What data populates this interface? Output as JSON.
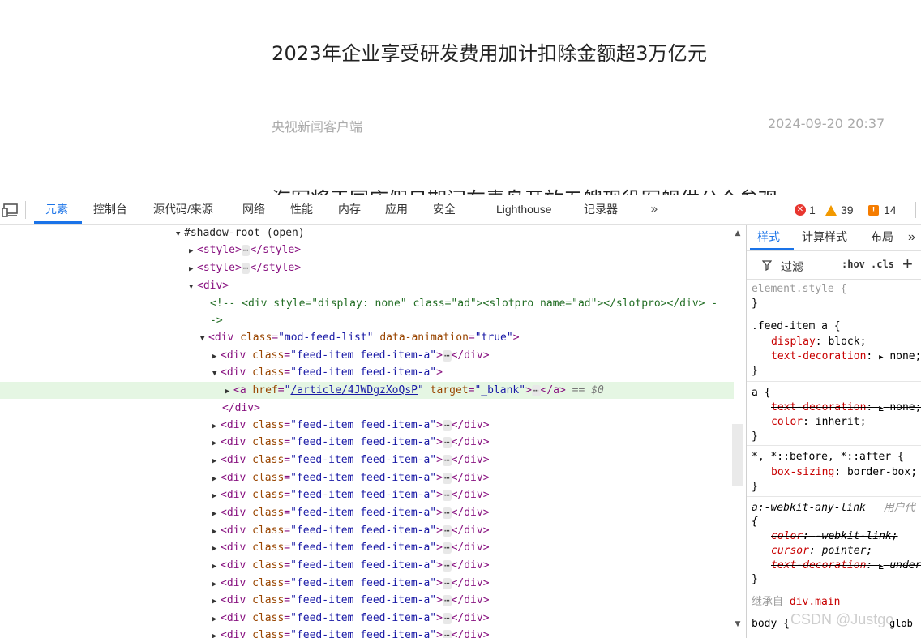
{
  "page": {
    "article_title": "2023年企业享受研发费用加计扣除金额超3万亿元",
    "source": "央视新闻客户端",
    "timestamp": "2024-09-20 20:37",
    "next_title": "海军将于国庆假日期间在青岛开放五艘现役军舰供公众参观"
  },
  "devtools": {
    "tabs": [
      "元素",
      "控制台",
      "源代码/来源",
      "网络",
      "性能",
      "内存",
      "应用",
      "安全",
      "Lighthouse",
      "记录器"
    ],
    "more": "»",
    "errors": "1",
    "warnings": "39",
    "issues": "14"
  },
  "dom_tree": {
    "shadow_root": "#shadow-root (open)",
    "style_open": "<style>",
    "style_close": "</style>",
    "div_open": "<div>",
    "comment": "<!-- <div style=\"display: none\" class=\"ad\"><slotpro name=\"ad\"></slotpro></div> -",
    "comment_end": "->",
    "div_word": "<div",
    "class_attr": "class",
    "mod_feed_list": "\"mod-feed-list\"",
    "data_animation_attr": "data-animation",
    "data_animation_val": "\"true\"",
    "feed_item_class": "\"feed-item feed-item-a\"",
    "a_open": "<a",
    "href_attr": "href",
    "href_val": "/article/4JWDgzXoQsP",
    "target_attr": "target",
    "target_val": "\"_blank\"",
    "a_close": "</a>",
    "eq_dollar": "== $0",
    "div_close": "</div>",
    "gt": ">",
    "eq": "=",
    "ellipsis": "⋯",
    "q": "\""
  },
  "styles_pane": {
    "tabs": [
      "样式",
      "计算样式",
      "布局"
    ],
    "more": "»",
    "filter_label": "过滤",
    "hov": ":hov",
    "cls": ".cls",
    "add": "+",
    "rules": {
      "element_style": "element.style {",
      "close": "}",
      "feed_item_a_sel": ".feed-item a {",
      "display_prop": "display",
      "display_val": "block;",
      "text_decoration_prop": "text-decoration",
      "none_val": "none;",
      "a_sel": "a {",
      "color_prop": "color",
      "inherit_val": "inherit;",
      "universal_sel": "*, *::before, *::after {",
      "box_sizing_prop": "box-sizing",
      "box_sizing_val": "border-box;",
      "webkit_sel": "a:-webkit-any-link",
      "user_agent": "用户代",
      "open_brace": "{",
      "webkit_link_val": "-webkit-link;",
      "cursor_prop": "cursor",
      "pointer_val": "pointer;",
      "underline_val": "under",
      "inherited_from": "继承自",
      "inherited_sel": "div.main",
      "body_sel": "body {",
      "body_extra": "glob"
    }
  },
  "watermark": "CSDN @Justgo",
  "colors": {
    "accent": "#1a73e8",
    "tag": "#881280",
    "attr": "#994500",
    "value": "#1a1aa6",
    "selected_row": "#e5f6e3"
  }
}
